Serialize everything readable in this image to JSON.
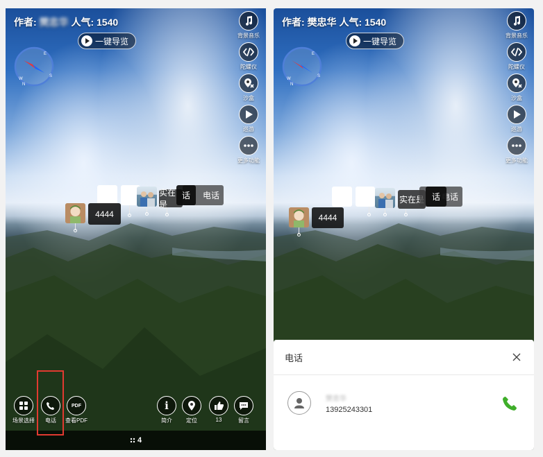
{
  "header": {
    "author_label": "作者:",
    "author_name": "樊忠华",
    "popularity_label": "人气:",
    "popularity_value": "1540"
  },
  "guide_button": {
    "label": "一键导览"
  },
  "compass": {
    "letters": [
      "E",
      "S",
      "W",
      "N"
    ]
  },
  "side_menu": [
    {
      "icon": "music-note-icon",
      "label": "背景音乐"
    },
    {
      "icon": "gyroscope-icon",
      "label": "陀螺仪"
    },
    {
      "icon": "sandbox-icon",
      "label": "沙盒"
    },
    {
      "icon": "play-icon",
      "label": "巡游"
    },
    {
      "icon": "more-icon",
      "label": "更多功能"
    }
  ],
  "hotspots": {
    "tag_4444": "4444",
    "tag_shizaishi": "实在是",
    "tag_dianhua": "电话",
    "tag_hua": "话"
  },
  "bottom_bar": {
    "scene_select": "场景选择",
    "phone": "电话",
    "view_pdf": "查看PDF",
    "pdf_badge": "PDF",
    "intro": "简介",
    "locate": "定位",
    "likes": "13",
    "comment": "留言"
  },
  "footer": {
    "count": "4"
  },
  "phone_sheet": {
    "title": "电话",
    "contact_name": "樊忠华",
    "phone_number": "13925243301"
  },
  "colors": {
    "accent_red": "#e23a31",
    "phone_green": "#3fae2a"
  }
}
